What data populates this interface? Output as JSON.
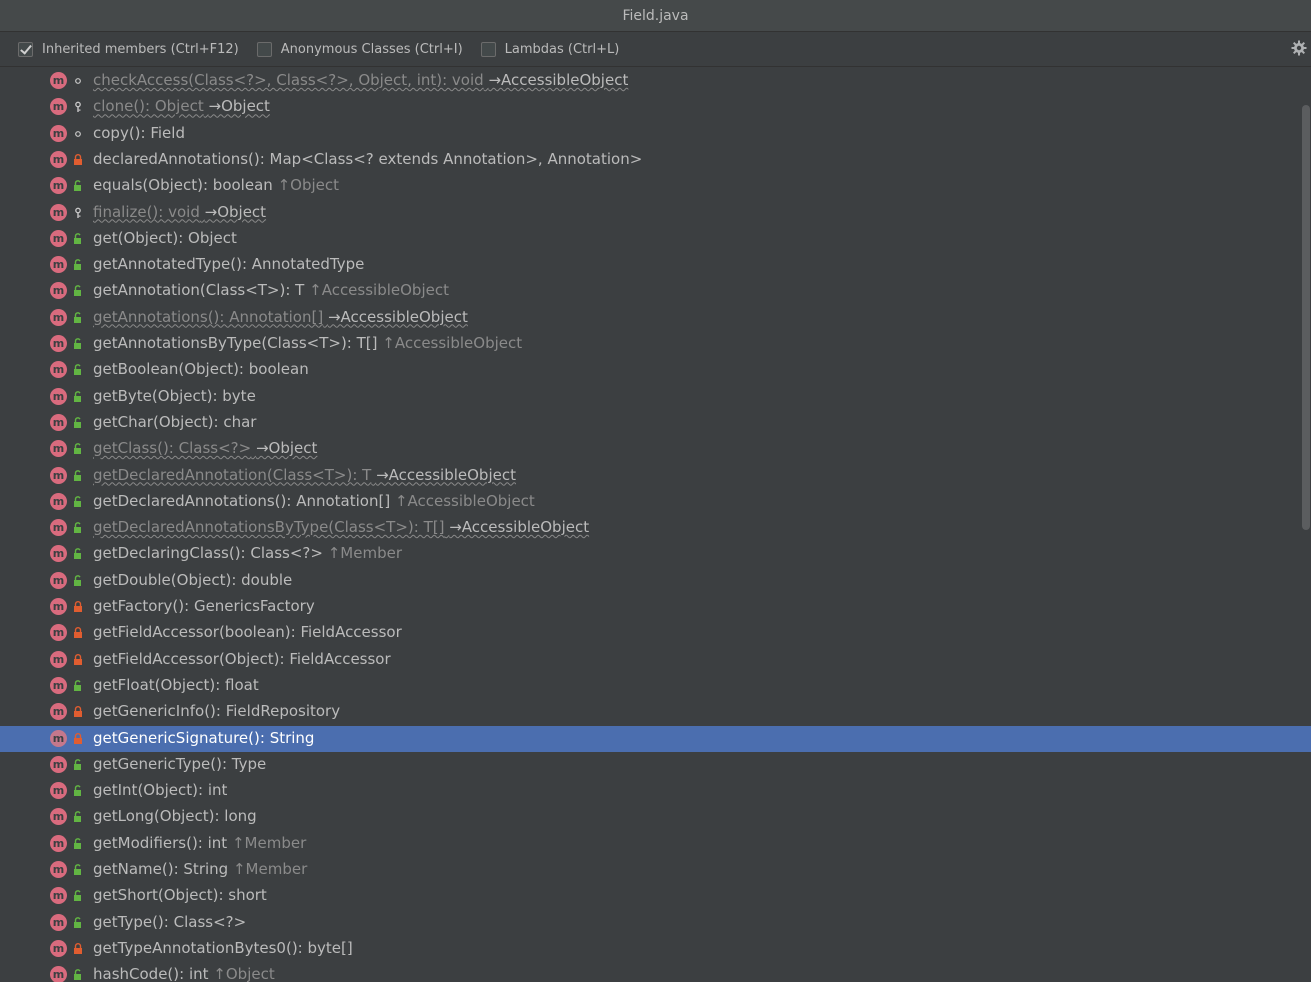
{
  "window": {
    "title": "Field.java"
  },
  "toolbar": {
    "options": [
      {
        "label": "Inherited members (Ctrl+F12)",
        "checked": true
      },
      {
        "label": "Anonymous Classes (Ctrl+I)",
        "checked": false
      },
      {
        "label": "Lambdas (Ctrl+L)",
        "checked": false
      }
    ],
    "settings_icon": "gear-icon"
  },
  "colors": {
    "method_icon": "#d96b7e",
    "public_lock": "#62b543",
    "private_lock": "#e05d30",
    "selection": "#4b6eaf"
  },
  "members": [
    {
      "text": "checkAccess(Class<?>, Class<?>, Object, int): void",
      "ann": "→AccessibleObject",
      "vis": "package",
      "dim": true
    },
    {
      "text": "clone(): Object",
      "ann": "→Object",
      "vis": "protected",
      "dim": true
    },
    {
      "text": "copy(): Field",
      "ann": "",
      "vis": "package",
      "dim": false
    },
    {
      "text": "declaredAnnotations(): Map<Class<? extends Annotation>, Annotation>",
      "ann": "",
      "vis": "private",
      "dim": false
    },
    {
      "text": "equals(Object): boolean",
      "ann": "↑Object",
      "vis": "public",
      "dim": false
    },
    {
      "text": "finalize(): void",
      "ann": "→Object",
      "vis": "protected",
      "dim": true
    },
    {
      "text": "get(Object): Object",
      "ann": "",
      "vis": "public",
      "dim": false
    },
    {
      "text": "getAnnotatedType(): AnnotatedType",
      "ann": "",
      "vis": "public",
      "dim": false
    },
    {
      "text": "getAnnotation(Class<T>): T",
      "ann": "↑AccessibleObject",
      "vis": "public",
      "dim": false
    },
    {
      "text": "getAnnotations(): Annotation[]",
      "ann": "→AccessibleObject",
      "vis": "public",
      "dim": true
    },
    {
      "text": "getAnnotationsByType(Class<T>): T[]",
      "ann": "↑AccessibleObject",
      "vis": "public",
      "dim": false
    },
    {
      "text": "getBoolean(Object): boolean",
      "ann": "",
      "vis": "public",
      "dim": false
    },
    {
      "text": "getByte(Object): byte",
      "ann": "",
      "vis": "public",
      "dim": false
    },
    {
      "text": "getChar(Object): char",
      "ann": "",
      "vis": "public",
      "dim": false
    },
    {
      "text": "getClass(): Class<?>",
      "ann": "→Object",
      "vis": "public",
      "dim": true
    },
    {
      "text": "getDeclaredAnnotation(Class<T>): T",
      "ann": "→AccessibleObject",
      "vis": "public",
      "dim": true
    },
    {
      "text": "getDeclaredAnnotations(): Annotation[]",
      "ann": "↑AccessibleObject",
      "vis": "public",
      "dim": false
    },
    {
      "text": "getDeclaredAnnotationsByType(Class<T>): T[]",
      "ann": "→AccessibleObject",
      "vis": "public",
      "dim": true
    },
    {
      "text": "getDeclaringClass(): Class<?>",
      "ann": "↑Member",
      "vis": "public",
      "dim": false
    },
    {
      "text": "getDouble(Object): double",
      "ann": "",
      "vis": "public",
      "dim": false
    },
    {
      "text": "getFactory(): GenericsFactory",
      "ann": "",
      "vis": "private",
      "dim": false
    },
    {
      "text": "getFieldAccessor(boolean): FieldAccessor",
      "ann": "",
      "vis": "private",
      "dim": false
    },
    {
      "text": "getFieldAccessor(Object): FieldAccessor",
      "ann": "",
      "vis": "private",
      "dim": false
    },
    {
      "text": "getFloat(Object): float",
      "ann": "",
      "vis": "public",
      "dim": false
    },
    {
      "text": "getGenericInfo(): FieldRepository",
      "ann": "",
      "vis": "private",
      "dim": false
    },
    {
      "text": "getGenericSignature(): String",
      "ann": "",
      "vis": "private",
      "dim": false,
      "selected": true
    },
    {
      "text": "getGenericType(): Type",
      "ann": "",
      "vis": "public",
      "dim": false
    },
    {
      "text": "getInt(Object): int",
      "ann": "",
      "vis": "public",
      "dim": false
    },
    {
      "text": "getLong(Object): long",
      "ann": "",
      "vis": "public",
      "dim": false
    },
    {
      "text": "getModifiers(): int",
      "ann": "↑Member",
      "vis": "public",
      "dim": false
    },
    {
      "text": "getName(): String",
      "ann": "↑Member",
      "vis": "public",
      "dim": false
    },
    {
      "text": "getShort(Object): short",
      "ann": "",
      "vis": "public",
      "dim": false
    },
    {
      "text": "getType(): Class<?>",
      "ann": "",
      "vis": "public",
      "dim": false
    },
    {
      "text": "getTypeAnnotationBytes0(): byte[]",
      "ann": "",
      "vis": "private",
      "dim": false
    },
    {
      "text": "hashCode(): int",
      "ann": "↑Object",
      "vis": "public",
      "dim": false
    }
  ]
}
